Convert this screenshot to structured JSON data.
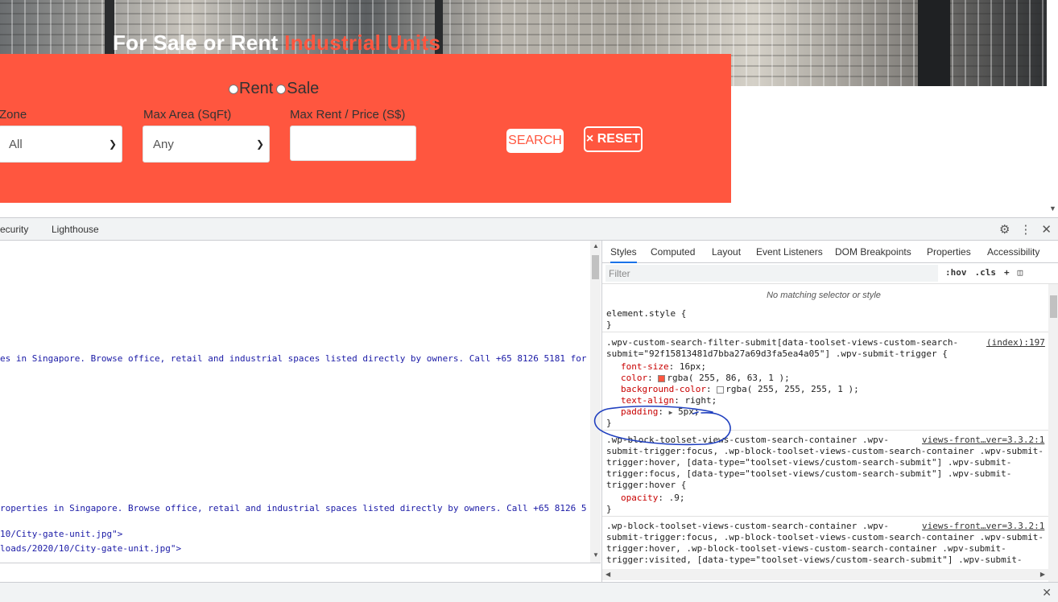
{
  "hero": {
    "title_main": "For Sale or Rent ",
    "title_accent": "Industrial Units"
  },
  "search": {
    "radio_rent": "Rent",
    "radio_sale": "Sale",
    "zone_label": "Zone",
    "zone_value": "All",
    "area_label": "Max Area (SqFt)",
    "area_value": "Any",
    "price_label": "Max Rent / Price (S$)",
    "price_value": "",
    "search_label": "SEARCH",
    "reset_label": "× RESET",
    "accent_color": "#ff563f"
  },
  "devtools": {
    "tabs": [
      "ecurity",
      "Lighthouse"
    ],
    "elements_lines": [
      "es in Singapore. Browse office, retail and industrial spaces listed directly by owners. Call +65 8126 5181 for",
      "roperties in Singapore. Browse office, retail and industrial spaces listed directly by owners. Call +65 8126 5",
      "10/City-gate-unit.jpg\">",
      "loads/2020/10/City-gate-unit.jpg\">"
    ],
    "styles_tabs": [
      "Styles",
      "Computed",
      "Layout",
      "Event Listeners",
      "DOM Breakpoints",
      "Properties",
      "Accessibility"
    ],
    "filter_placeholder": "Filter",
    "hov": ":hov",
    "cls": ".cls",
    "plus": "+",
    "no_match": "No matching selector or style",
    "element_style": "element.style {",
    "close_brace": "}",
    "rule1": {
      "selector_1": ".wpv-custom-search-filter-submit[data-toolset-views-custom-search-",
      "selector_2": "submit=\"92f15813481d7bba27a69d3fa5ea4a05\"] .wpv-submit-trigger {",
      "source": "(index):197",
      "decls": [
        {
          "prop": "font-size",
          "val": "16px;"
        },
        {
          "prop": "color",
          "val": "rgba( 255, 86, 63, 1 );",
          "swatch": "#ff563f"
        },
        {
          "prop": "background-color",
          "val": "rgba( 255, 255, 255, 1 );",
          "swatch": "#ffffff"
        },
        {
          "prop": "text-align",
          "val": "right;"
        },
        {
          "prop": "padding",
          "val": "5px;"
        }
      ]
    },
    "rule2": {
      "lines": [
        ".wp-block-toolset-views-custom-search-container .wpv-",
        "submit-trigger:focus, .wp-block-toolset-views-custom-search-container .wpv-submit-",
        "trigger:hover, [data-type=\"toolset-views/custom-search-submit\"] .wpv-submit-",
        "trigger:focus, [data-type=\"toolset-views/custom-search-submit\"] .wpv-submit-",
        "trigger:hover {"
      ],
      "source": "views-front…ver=3.3.2:1",
      "decl_prop": "opacity",
      "decl_val": ".9;"
    },
    "rule3": {
      "lines": [
        ".wp-block-toolset-views-custom-search-container .wpv-",
        "submit-trigger:focus, .wp-block-toolset-views-custom-search-container .wpv-submit-",
        "trigger:hover, .wp-block-toolset-views-custom-search-container .wpv-submit-",
        "trigger:visited, [data-type=\"toolset-views/custom-search-submit\"] .wpv-submit-"
      ],
      "source": "views-front…ver=3.3.2:1"
    },
    "annotation_color": "#1f3fbf"
  }
}
